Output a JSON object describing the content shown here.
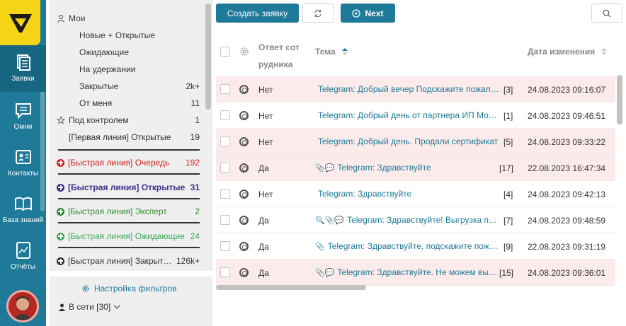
{
  "rail": {
    "items": [
      {
        "label": "Заявки",
        "icon": "tickets-icon",
        "active": true
      },
      {
        "label": "Омни",
        "icon": "chat-icon",
        "active": false
      },
      {
        "label": "Контакты",
        "icon": "contacts-icon",
        "active": false
      },
      {
        "label": "База знаний",
        "icon": "book-icon",
        "active": false
      },
      {
        "label": "Отчёты",
        "icon": "reports-icon",
        "active": false
      }
    ]
  },
  "filters": {
    "group_title": "Мои",
    "items": [
      {
        "label": "Новые + Открытые",
        "count": ""
      },
      {
        "label": "Ожидающие",
        "count": ""
      },
      {
        "label": "На удержании",
        "count": ""
      },
      {
        "label": "Закрытые",
        "count": "2k+"
      },
      {
        "label": "От меня",
        "count": "11"
      }
    ],
    "control": {
      "label": "Под контролем",
      "count": "1"
    },
    "first_line": {
      "label": "[Первая линия] Открытые",
      "count": "19"
    },
    "queues": [
      {
        "label": "[Быстрая линия] Очередь",
        "count": "192",
        "color": "#d11f1f",
        "bold": false
      },
      {
        "label": "[Быстрая линия] Открытые",
        "count": "31",
        "color": "#3b2f8a",
        "bold": true
      },
      {
        "label": "[Быстрая линия] Эксперт",
        "count": "2",
        "color": "#2e8b2e",
        "bold": false
      },
      {
        "label": "[Быстрая линия] Ожидающие",
        "count": "24",
        "color": "#3aa857",
        "bold": false
      },
      {
        "label": "[Быстрая линия] Закрытые",
        "count": "126k+",
        "color": "#333333",
        "bold": false
      }
    ],
    "settings_label": "Настройка фильтров",
    "online_label": "В сети [30]"
  },
  "toolbar": {
    "create_label": "Создать заявку",
    "next_label": "Next"
  },
  "table": {
    "columns": {
      "reply_line1": "Ответ сот",
      "reply_line2": "рудника",
      "topic": "Тема",
      "date": "Дата изменения"
    },
    "rows": [
      {
        "reply": "Нет",
        "topic": "Telegram: Добрый вечер Подскажите пожалуйста",
        "count": "[3]",
        "date": "24.08.2023 09:16:07",
        "highlight": true,
        "icons": ""
      },
      {
        "reply": "Нет",
        "topic": "Telegram: Добрый день от партнера ИП Моисеев",
        "count": "[1]",
        "date": "24.08.2023 09:46:51",
        "highlight": false,
        "icons": ""
      },
      {
        "reply": "Нет",
        "topic": "Telegram: Добрый день. Продали сертификат",
        "count": "[5]",
        "date": "24.08.2023 09:33:22",
        "highlight": true,
        "icons": ""
      },
      {
        "reply": "Да",
        "topic": "Telegram: Здравствуйте",
        "count": "[17]",
        "date": "22.08.2023 16:47:34",
        "highlight": true,
        "icons": "📎💬"
      },
      {
        "reply": "Нет",
        "topic": "Telegram: Здравствуйте",
        "count": "[4]",
        "date": "24.08.2023 09:42:13",
        "highlight": false,
        "icons": ""
      },
      {
        "reply": "Да",
        "topic": "Telegram: Здравствуйте! Выгрузка продаж",
        "count": "[7]",
        "date": "24.08.2023 09:48:59",
        "highlight": false,
        "icons": "🔍📎💬"
      },
      {
        "reply": "Да",
        "topic": "Telegram: Здравствуйте, подскажите пожалуйста",
        "count": "[9]",
        "date": "22.08.2023 09:31:19",
        "highlight": false,
        "icons": "📎"
      },
      {
        "reply": "Да",
        "topic": "Telegram: Здравствуйте. Не можем выгрузить",
        "count": "[15]",
        "date": "24.08.2023 09:36:01",
        "highlight": true,
        "icons": "📎💬"
      }
    ]
  }
}
